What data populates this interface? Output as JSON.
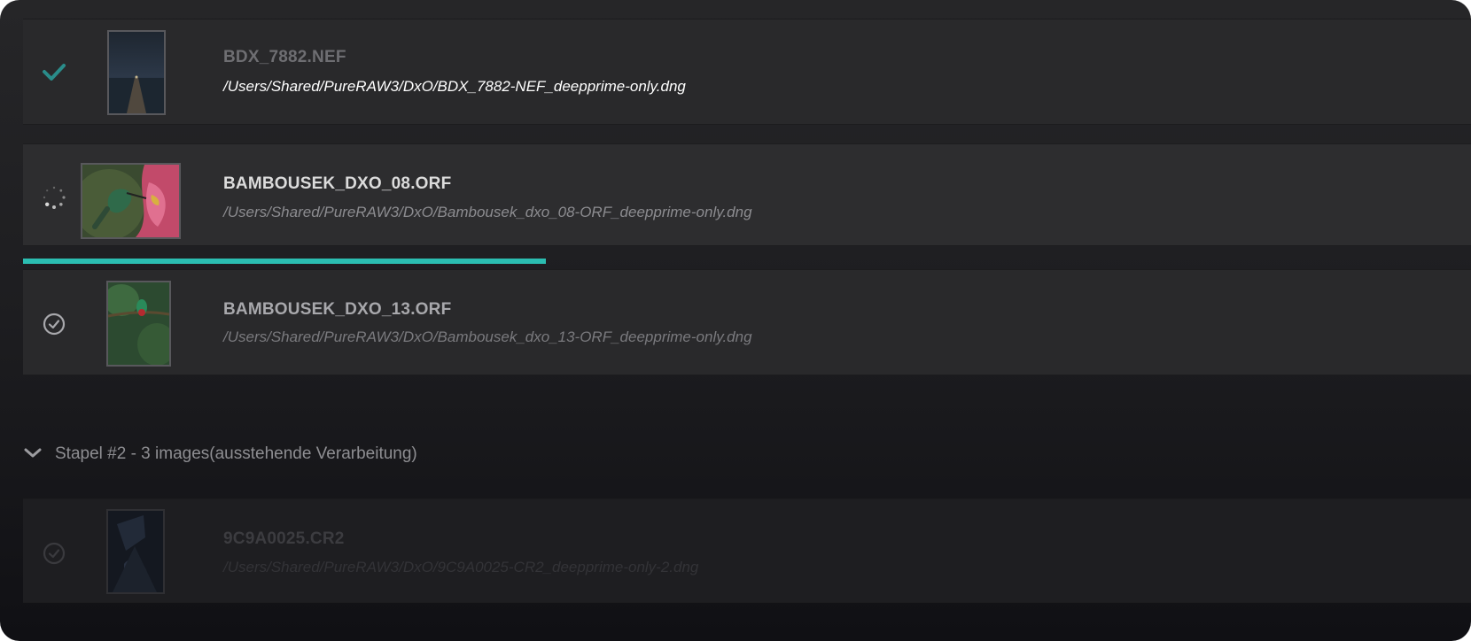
{
  "queue": {
    "items": [
      {
        "filename": "BDX_7882.NEF",
        "output_path": "/Users/Shared/PureRAW3/DxO/BDX_7882-NEF_deepprime-only.dng",
        "status": "done",
        "status_icon": "checkmark-icon"
      },
      {
        "filename": "BAMBOUSEK_DXO_08.ORF",
        "output_path": "/Users/Shared/PureRAW3/DxO/Bambousek_dxo_08-ORF_deepprime-only.dng",
        "status": "processing",
        "status_icon": "spinner-icon",
        "progress": 0.36
      },
      {
        "filename": "BAMBOUSEK_DXO_13.ORF",
        "output_path": "/Users/Shared/PureRAW3/DxO/Bambousek_dxo_13-ORF_deepprime-only.dng",
        "status": "queued",
        "status_icon": "clock-check-icon"
      }
    ]
  },
  "group": {
    "label": "Stapel #2 - 3 images(ausstehende Verarbeitung)",
    "icon": "chevron-down-icon",
    "items": [
      {
        "filename": "9C9A0025.CR2",
        "output_path": "/Users/Shared/PureRAW3/DxO/9C9A0025-CR2_deepprime-only-2.dng",
        "status": "pending",
        "status_icon": "clock-check-icon"
      }
    ]
  },
  "colors": {
    "accent": "#2bbdb1",
    "checkmark": "#2a8c8a"
  }
}
